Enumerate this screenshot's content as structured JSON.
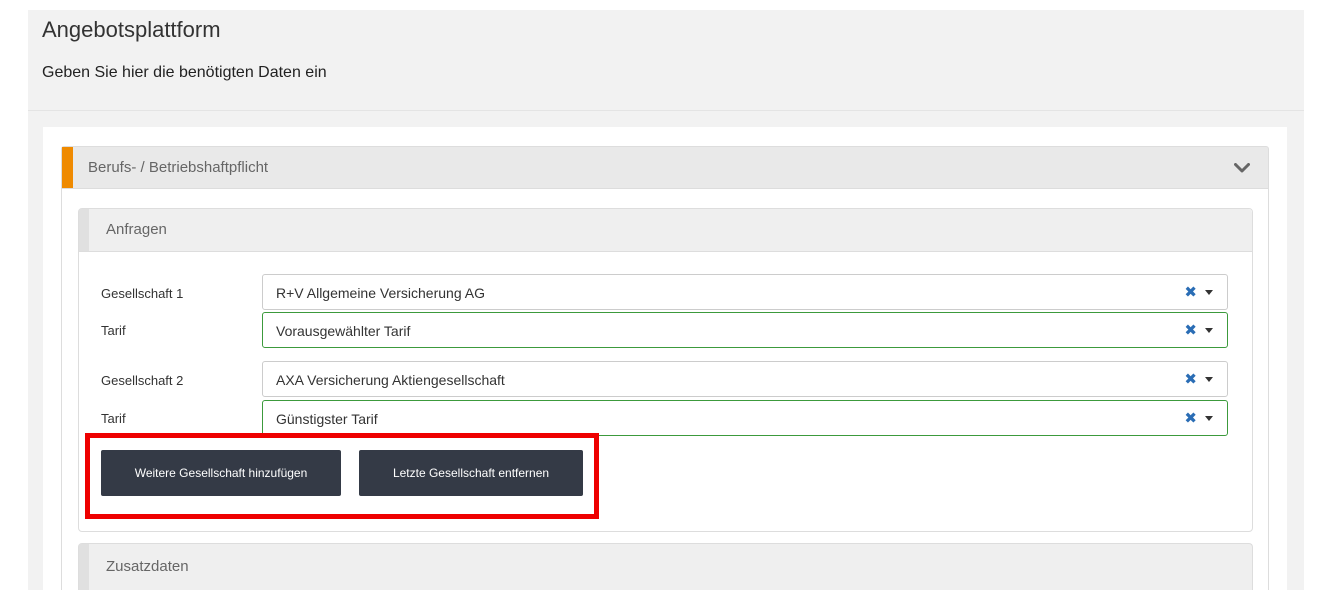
{
  "page": {
    "title": "Angebotsplattform",
    "subtitle": "Geben Sie hier die benötigten Daten ein"
  },
  "panel": {
    "title": "Berufs- / Betriebshaftpflicht",
    "accent_color": "#ef8a00",
    "toggle_icon": "chevron-down-icon"
  },
  "anfragen": {
    "title": "Anfragen",
    "rows": [
      {
        "label": "Gesellschaft 1",
        "value": "R+V Allgemeine Versicherung AG"
      },
      {
        "label": "Tarif",
        "value": "Vorausgewählter Tarif"
      },
      {
        "label": "Gesellschaft 2",
        "value": "AXA Versicherung Aktiengesellschaft"
      },
      {
        "label": "Tarif",
        "value": "Günstigster Tarif"
      }
    ],
    "clear_symbol": "✖",
    "add_button": "Weitere Gesellschaft hinzufügen",
    "remove_button": "Letzte Gesellschaft entfernen"
  },
  "zusatzdaten": {
    "title": "Zusatzdaten"
  },
  "colors": {
    "button_bg": "#343a46",
    "valid_border": "#3c9a3c",
    "clear_icon": "#2a6db5",
    "highlight": "#ee0000"
  }
}
